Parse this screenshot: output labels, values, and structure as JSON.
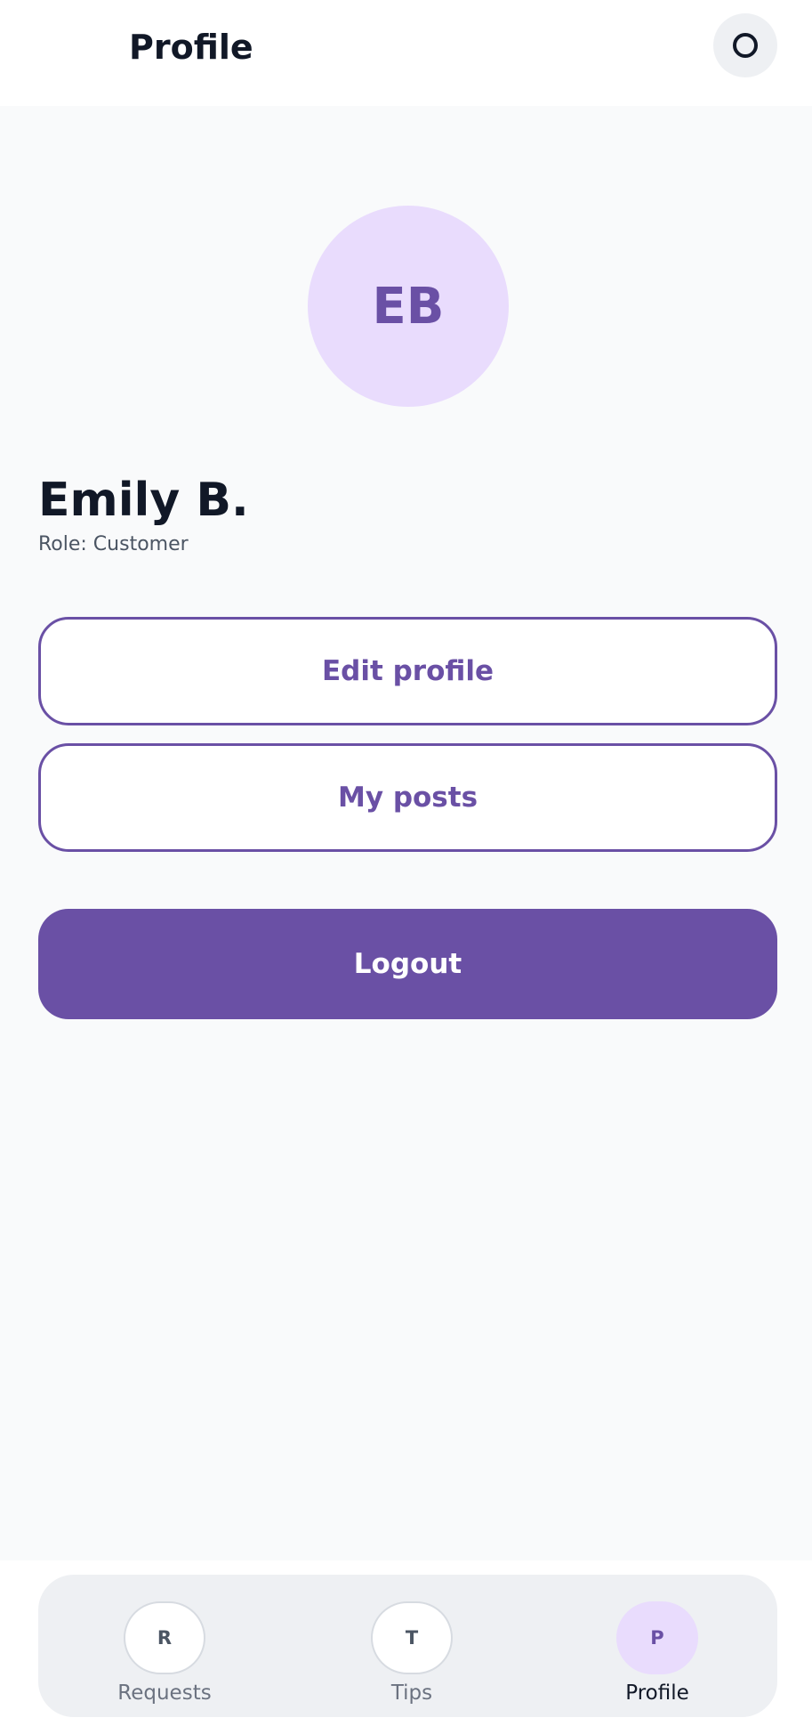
{
  "header": {
    "title": "Profile",
    "settings_icon": "circle-icon"
  },
  "profile": {
    "avatar_initials": "EB",
    "name": "Emily B.",
    "role": "Role: Customer"
  },
  "actions": {
    "edit_profile_label": "Edit profile",
    "my_posts_label": "My posts",
    "logout_label": "Logout"
  },
  "tabs": [
    {
      "icon_letter": "R",
      "label": "Requests",
      "active": false
    },
    {
      "icon_letter": "T",
      "label": "Tips",
      "active": false
    },
    {
      "icon_letter": "P",
      "label": "Profile",
      "active": true
    }
  ],
  "colors": {
    "accent": "#6a50a5",
    "accent_light": "#e9dcfd",
    "background": "#f9fafb",
    "text_primary": "#111827"
  }
}
